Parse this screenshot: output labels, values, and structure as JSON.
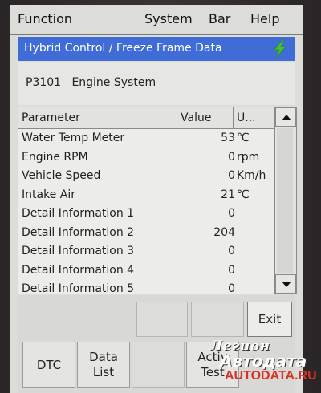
{
  "menu": {
    "function": "Function",
    "system": "System",
    "bar": "Bar",
    "help": "Help"
  },
  "title": "Hybrid Control / Freeze Frame Data",
  "title_icon": "lightning-bolt-icon",
  "accent_color": "#3f6cd6",
  "bolt_color": "#44c233",
  "code": {
    "id": "P3101",
    "description": "Engine System"
  },
  "table": {
    "headers": {
      "parameter": "Parameter",
      "value": "Value",
      "unit": "U..."
    },
    "rows": [
      {
        "parameter": "Water Temp Meter",
        "value": "53",
        "unit": "℃"
      },
      {
        "parameter": "Engine RPM",
        "value": "0",
        "unit": "rpm"
      },
      {
        "parameter": "Vehicle Speed",
        "value": "0",
        "unit": "Km/h"
      },
      {
        "parameter": "Intake Air",
        "value": "21",
        "unit": "℃"
      },
      {
        "parameter": "Detail Information 1",
        "value": "0",
        "unit": ""
      },
      {
        "parameter": "Detail Information 2",
        "value": "204",
        "unit": ""
      },
      {
        "parameter": "Detail Information 3",
        "value": "0",
        "unit": ""
      },
      {
        "parameter": "Detail Information 4",
        "value": "0",
        "unit": ""
      },
      {
        "parameter": "Detail Information 5",
        "value": "0",
        "unit": ""
      }
    ],
    "scroll_up_icon": "triangle-up-icon",
    "scroll_down_icon": "triangle-down-icon"
  },
  "buttons": {
    "upper_disabled_1": "",
    "upper_disabled_2": "",
    "exit": "Exit",
    "dtc": "DTC",
    "data_list_line1": "Data",
    "data_list_line2": "List",
    "disabled_3": "",
    "active_test_line1": "Activ",
    "active_test_line2": "Test"
  },
  "watermark": {
    "line1": "Легион",
    "line2": "Автодата",
    "line3": "AUTODATA.RU"
  }
}
